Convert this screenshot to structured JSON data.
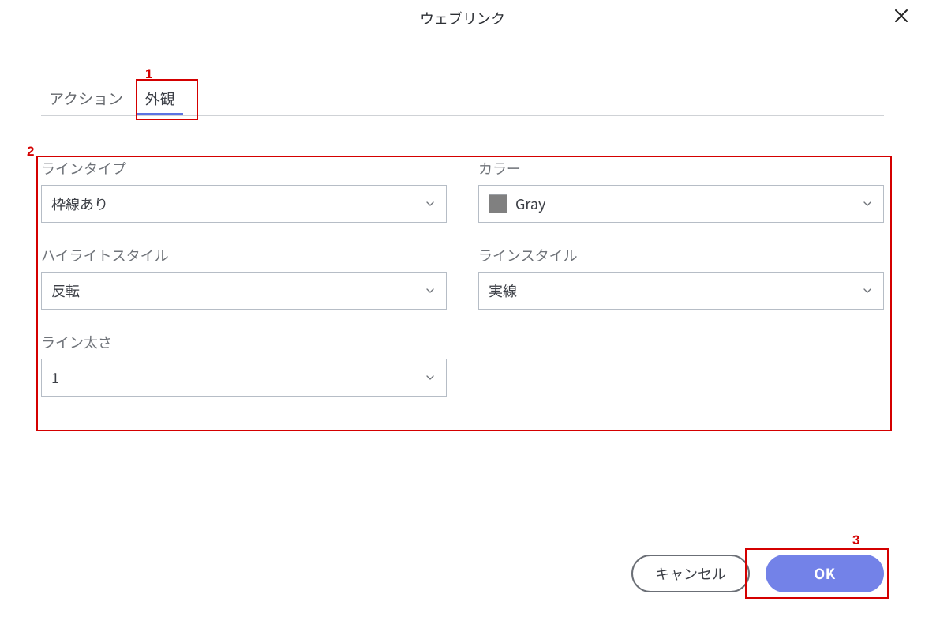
{
  "dialog": {
    "title": "ウェブリンク"
  },
  "tabs": {
    "action": "アクション",
    "appearance": "外観"
  },
  "fields": {
    "line_type": {
      "label": "ラインタイプ",
      "value": "枠線あり"
    },
    "color": {
      "label": "カラー",
      "value": "Gray",
      "swatch_hex": "#808080"
    },
    "highlight_style": {
      "label": "ハイライトスタイル",
      "value": "反転"
    },
    "line_style": {
      "label": "ラインスタイル",
      "value": "実線"
    },
    "line_thickness": {
      "label": "ライン太さ",
      "value": "1"
    }
  },
  "buttons": {
    "cancel": "キャンセル",
    "ok": "OK"
  },
  "callouts": {
    "one": "1",
    "two": "2",
    "three": "3"
  }
}
